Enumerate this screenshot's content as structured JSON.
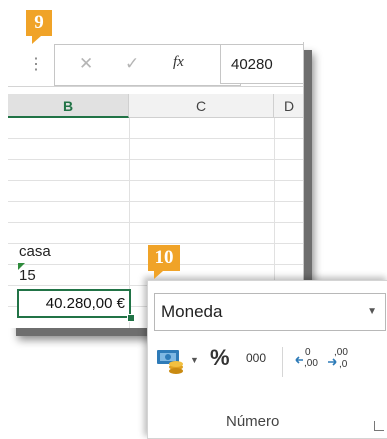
{
  "badges": {
    "step9": "9",
    "step10": "10"
  },
  "formula_bar": {
    "cancel_icon": "✕",
    "enter_icon": "✓",
    "fx_label": "fx",
    "value": "40280"
  },
  "columns": [
    "B",
    "C",
    "D"
  ],
  "cells": {
    "b6": "casa",
    "b7": "15",
    "b8": "40.280,00 €"
  },
  "ribbon": {
    "number_format": "Moneda",
    "dropdown_arrow": "▼",
    "currency_arrow": "▼",
    "percent": "%",
    "thousands": "000",
    "increase_decimals": "←0 .00",
    "decrease_decimals": ".00 →0",
    "group_label": "Número"
  },
  "colors": {
    "excel_green": "#217346",
    "badge_orange": "#f0a328"
  }
}
